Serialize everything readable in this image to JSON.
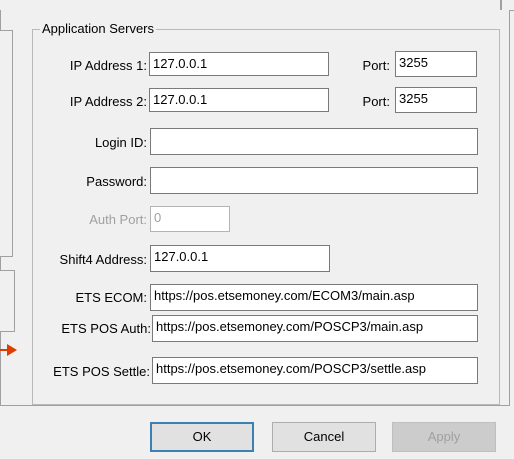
{
  "group": {
    "title": "Application Servers"
  },
  "ip1": {
    "label": "IP Address 1:",
    "value": "127.0.0.1",
    "port_label": "Port:",
    "port_value": "3255"
  },
  "ip2": {
    "label": "IP Address 2:",
    "value": "127.0.0.1",
    "port_label": "Port:",
    "port_value": "3255"
  },
  "login": {
    "label": "Login ID:",
    "value": ""
  },
  "password": {
    "label": "Password:",
    "value": ""
  },
  "auth_port": {
    "label": "Auth Port:",
    "value": "0"
  },
  "shift4": {
    "label": "Shift4 Address:",
    "value": "127.0.0.1"
  },
  "ets_ecom": {
    "label": "ETS ECOM:",
    "value": "https://pos.etsemoney.com/ECOM3/main.asp"
  },
  "ets_pos_auth": {
    "label": "ETS POS Auth:",
    "value": "https://pos.etsemoney.com/POSCP3/main.asp"
  },
  "ets_pos_settle": {
    "label": "ETS POS Settle:",
    "value": "https://pos.etsemoney.com/POSCP3/settle.asp"
  },
  "buttons": {
    "ok": "OK",
    "cancel": "Cancel",
    "apply": "Apply"
  },
  "colors": {
    "arrow": "#e03c00",
    "default_button_border": "#3c7fb1"
  }
}
